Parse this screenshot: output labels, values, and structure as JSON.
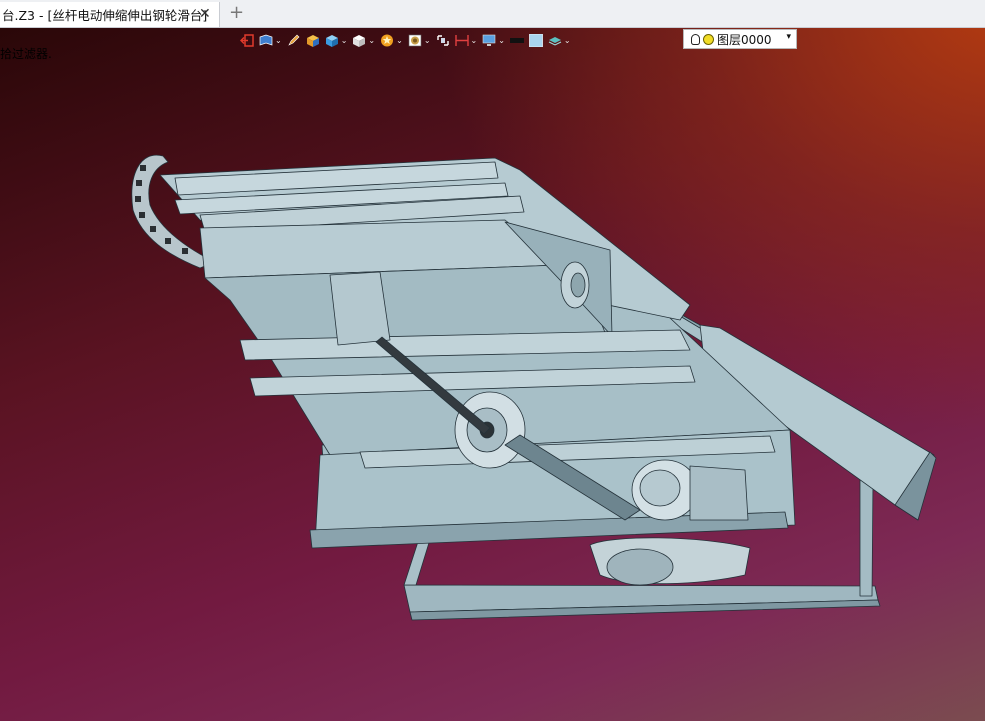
{
  "window": {
    "tab_title": "台.Z3 - [丝杆电动伸缩伸出钢轮滑台]",
    "close_glyph": "✕",
    "new_tab_glyph": "+"
  },
  "viewport": {
    "hint_text": "拾过滤器.",
    "toolbar": {
      "items": [
        {
          "name": "exit-icon",
          "dropdown": false,
          "color": "#e03a2c"
        },
        {
          "name": "book-icon",
          "dropdown": true,
          "color": "#3f7fd0"
        },
        {
          "name": "pencil-icon",
          "dropdown": false,
          "color": "#e8a23a"
        },
        {
          "name": "box-orange-icon",
          "dropdown": false,
          "color": "#e39a2a"
        },
        {
          "name": "cube-blue-icon",
          "dropdown": true,
          "color": "#3a9be0"
        },
        {
          "name": "cube-white-icon",
          "dropdown": true,
          "color": "#f2f2f2"
        },
        {
          "name": "sphere-star-icon",
          "dropdown": true,
          "color": "#f0a020"
        },
        {
          "name": "target-view-icon",
          "dropdown": true,
          "color": "#c8a04a"
        },
        {
          "name": "fit-view-icon",
          "dropdown": false,
          "color": "#cfd8e8"
        },
        {
          "name": "dimension-icon",
          "dropdown": true,
          "color": "#e04040"
        },
        {
          "name": "display-icon",
          "dropdown": true,
          "color": "#5aa0e0"
        },
        {
          "name": "black-rect-icon",
          "dropdown": false,
          "color": "#111111"
        },
        {
          "name": "lightblue-square-icon",
          "dropdown": false,
          "color": "#a9d4ef"
        },
        {
          "name": "layers-stack-icon",
          "dropdown": true,
          "color": "#5cc0c0"
        }
      ],
      "layer": {
        "name": "图层0000",
        "arrow": "▾",
        "bulb_icon": "lightbulb-icon",
        "dot_color": "#f1dc26"
      }
    }
  }
}
